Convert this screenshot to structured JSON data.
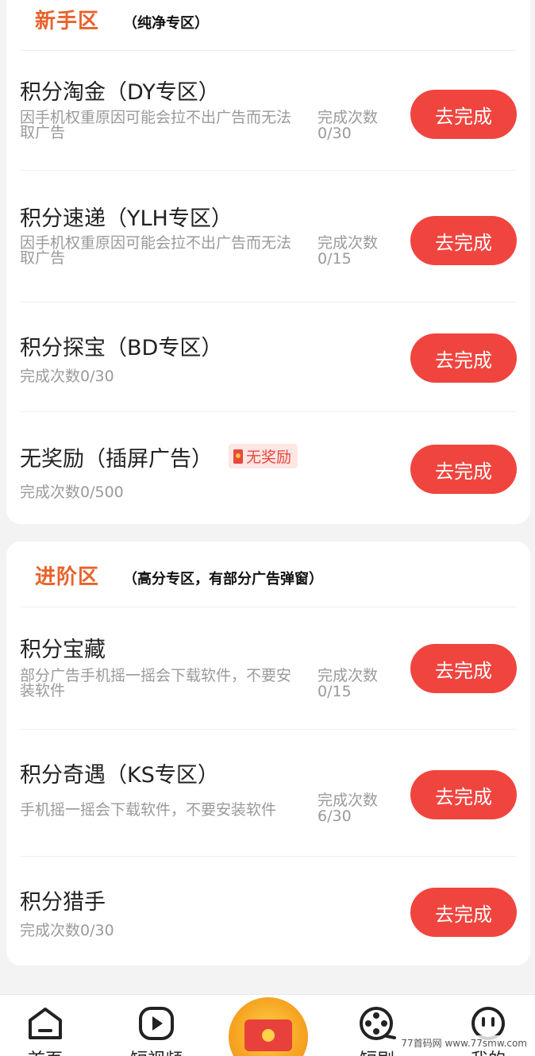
{
  "sections": [
    {
      "title": "新手区",
      "subtitle": "（纯净专区）",
      "tasks": [
        {
          "title": "积分淘金（DY专区）",
          "desc": "因手机权重原因可能会拉不出广告而无法取广告",
          "count_label": "完成次数",
          "count": "0/30",
          "button": "去完成"
        },
        {
          "title": "积分速递（YLH专区）",
          "desc": "因手机权重原因可能会拉不出广告而无法取广告",
          "count_label": "完成次数",
          "count": "0/15",
          "button": "去完成"
        },
        {
          "title": "积分探宝（BD专区）",
          "count_text": "完成次数0/30",
          "button": "去完成"
        },
        {
          "title": "无奖励（插屏广告）",
          "badge": "无奖励",
          "count_text": "完成次数0/500",
          "button": "去完成"
        }
      ]
    },
    {
      "title": "进阶区",
      "subtitle": "（高分专区，有部分广告弹窗）",
      "tasks": [
        {
          "title": "积分宝藏",
          "desc": "部分广告手机摇一摇会下载软件，不要安装软件",
          "count_label": "完成次数",
          "count": "0/15",
          "button": "去完成"
        },
        {
          "title": "积分奇遇（KS专区）",
          "desc": "手机摇一摇会下载软件，不要安装软件",
          "count_label": "完成次数",
          "count": "6/30",
          "button": "去完成"
        },
        {
          "title": "积分猎手",
          "count_text": "完成次数0/30",
          "button": "去完成"
        }
      ]
    }
  ],
  "tabbar": {
    "items": [
      {
        "label": "首页",
        "icon": "home-icon"
      },
      {
        "label": "短视频",
        "icon": "play-icon"
      },
      {
        "label": "",
        "icon": "red-envelope-icon"
      },
      {
        "label": "短剧",
        "icon": "film-reel-icon"
      },
      {
        "label": "我的",
        "icon": "profile-face-icon"
      }
    ]
  },
  "watermark": "77首码网 www.77smw.com",
  "colors": {
    "accent": "#f0453f",
    "section_title": "#e8622c",
    "muted": "#9a9a9a"
  }
}
